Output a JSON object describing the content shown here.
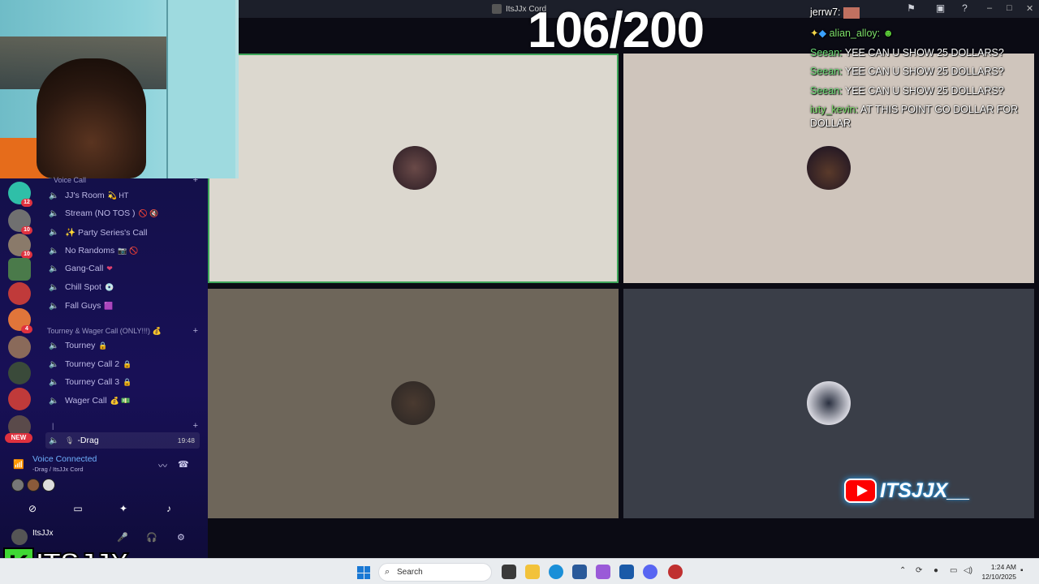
{
  "window": {
    "title": "ItsJJx Cord"
  },
  "overlay": {
    "counter": "106/200",
    "yt_handle": "ITSJJX__",
    "logo_text": "ITSJJX",
    "logo_letter": "K"
  },
  "chat": [
    {
      "name": "jerrw7:",
      "text": ""
    },
    {
      "name": "alian_alloy:",
      "text": ""
    },
    {
      "name": "Seean:",
      "text": "YEE CAN U SHOW 25 DOLLARS?"
    },
    {
      "name": "Seean:",
      "text": "YEE CAN U SHOW 25 DOLLARS?"
    },
    {
      "name": "Seean:",
      "text": "YEE CAN U SHOW 25 DOLLARS?"
    },
    {
      "name": "iuty_kevin:",
      "text": "AT THIS POINT GO DOLLAR FOR DOLLAR"
    }
  ],
  "sidebar": {
    "category_voice": "Voice Call",
    "channels_voice": [
      {
        "label": "JJ's Room",
        "emoji": "💫 HT"
      },
      {
        "label": "Stream (NO TOS )",
        "emoji": "🚫 🔇"
      },
      {
        "label": "✨ Party Series's Call",
        "emoji": ""
      },
      {
        "label": "No Randoms",
        "emoji": "📷 🚫"
      },
      {
        "label": "Gang-Call",
        "emoji": "❤"
      },
      {
        "label": "Chill Spot",
        "emoji": "💿"
      },
      {
        "label": "Fall Guys",
        "emoji": "🟪"
      }
    ],
    "category_tourney": "Tourney & Wager Call (ONLY!!!) 💰",
    "channels_tourney": [
      {
        "label": "Tourney",
        "emoji": "🔒"
      },
      {
        "label": "Tourney Call 2",
        "emoji": "🔒"
      },
      {
        "label": "Tourney Call 3",
        "emoji": "🔒"
      },
      {
        "label": "Wager Call",
        "emoji": "💰 💵"
      }
    ],
    "category_misc": "|",
    "active_channel": {
      "label": "-Drag",
      "time": "19:48"
    },
    "server_badges": [
      "12",
      "10",
      "10",
      "",
      "",
      "4",
      "",
      "",
      "",
      ""
    ],
    "new_badge": "NEW"
  },
  "voice": {
    "status": "Voice Connected",
    "location": "-Drag / ItsJJx Cord"
  },
  "user": {
    "name": "ItsJJx"
  },
  "taskbar": {
    "search_placeholder": "Search",
    "time": "1:24 AM",
    "date": "12/10/2025"
  },
  "colors": {
    "sidebar": "#181057",
    "accent_green": "#3fd834",
    "chat_name": "#6fe07a",
    "voice_connected": "#6fb1ff"
  }
}
